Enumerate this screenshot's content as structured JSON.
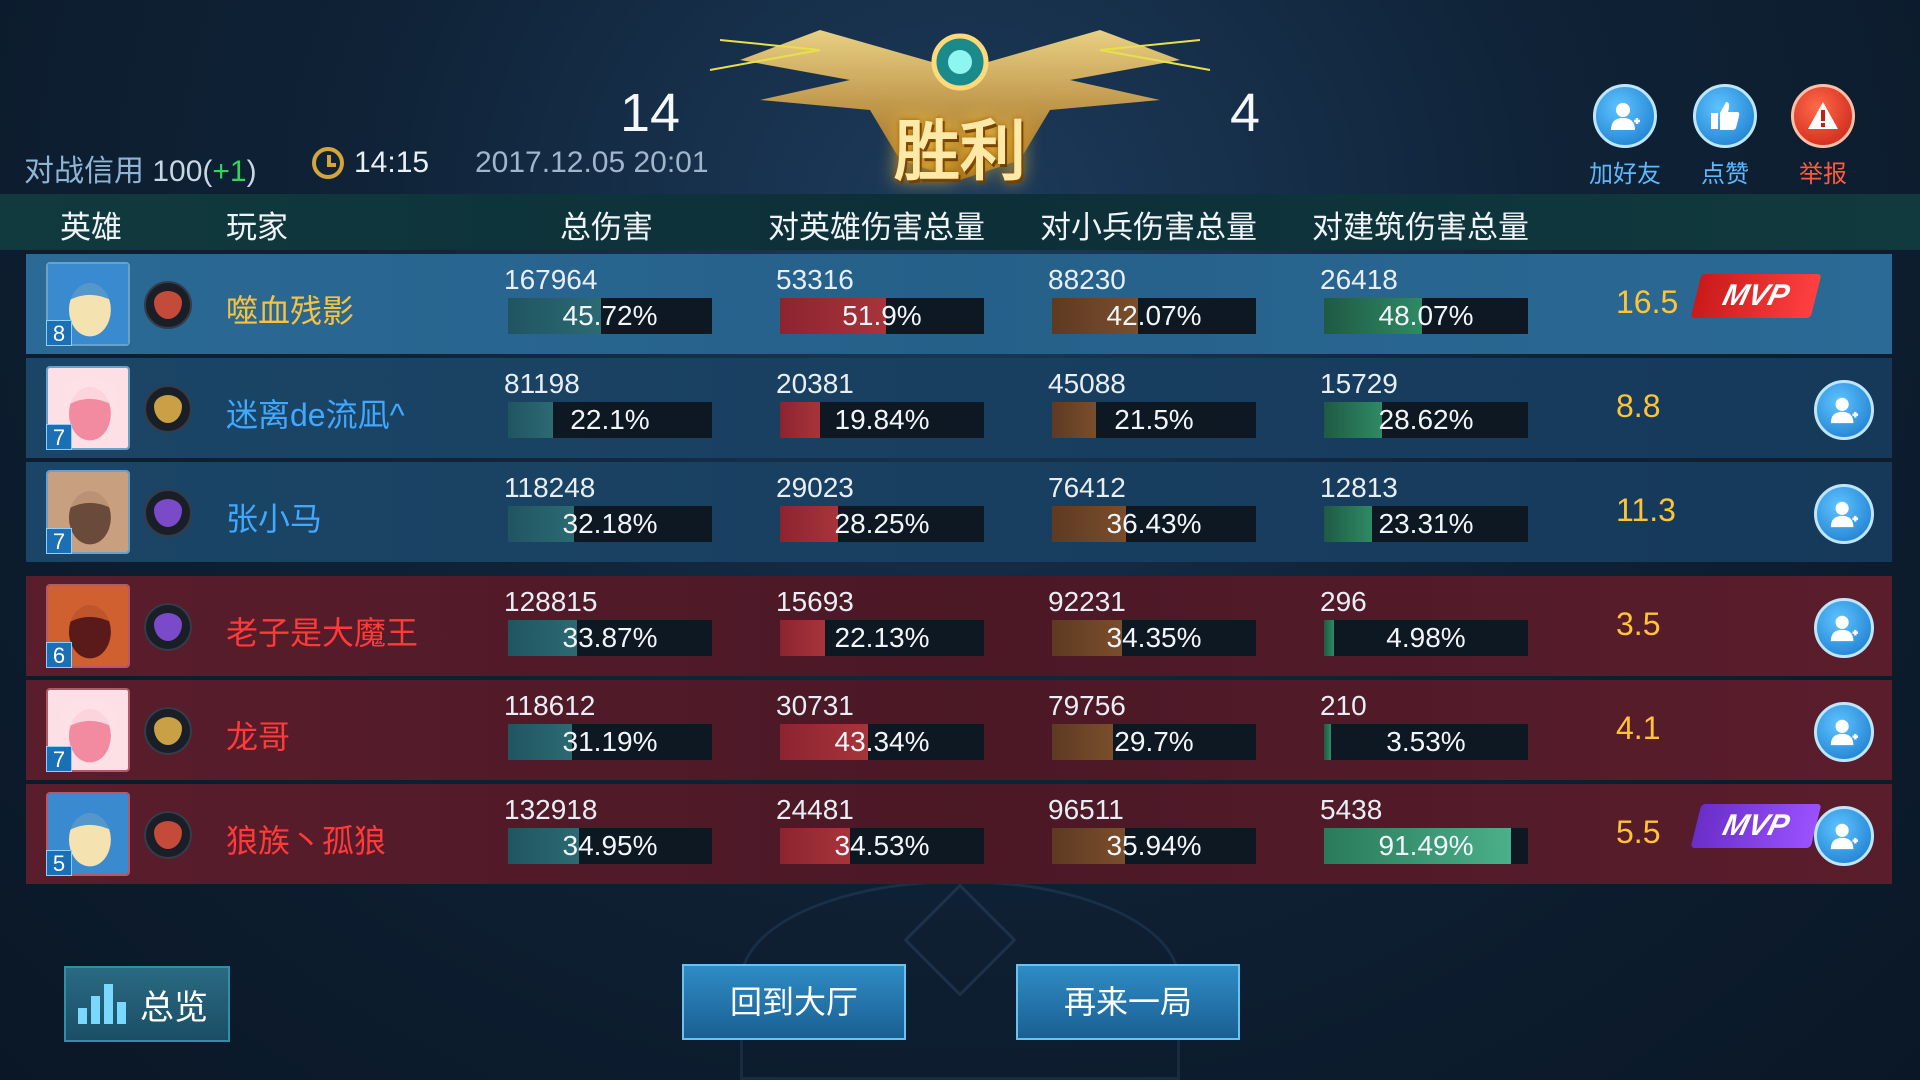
{
  "header": {
    "credit_label": "对战信用",
    "credit_value": "100(",
    "credit_delta": "+1",
    "credit_close": ")",
    "duration": "14:15",
    "datetime": "2017.12.05 20:01",
    "score_left": "14",
    "score_right": "4",
    "victory_text": "胜利",
    "actions": {
      "add_friend": "加好友",
      "like": "点赞",
      "report": "举报"
    }
  },
  "columns": {
    "hero": "英雄",
    "player": "玩家",
    "total_damage": "总伤害",
    "hero_damage": "对英雄伤害总量",
    "minion_damage": "对小兵伤害总量",
    "building_damage": "对建筑伤害总量"
  },
  "rows": [
    {
      "team": "blue",
      "level": "8",
      "name": "噬血残影",
      "name_color": "gold",
      "total": "167964",
      "total_pct": "45.72%",
      "total_frac": 0.4572,
      "hero": "53316",
      "hero_pct": "51.9%",
      "hero_frac": 0.519,
      "minion": "88230",
      "minion_pct": "42.07%",
      "minion_frac": 0.4207,
      "building": "26418",
      "building_pct": "48.07%",
      "building_frac": 0.4807,
      "rating": "16.5",
      "mvp": "MVP",
      "mvp_color": "red"
    },
    {
      "team": "blue",
      "level": "7",
      "name": "迷离de流凪^",
      "name_color": "blue",
      "total": "81198",
      "total_pct": "22.1%",
      "total_frac": 0.221,
      "hero": "20381",
      "hero_pct": "19.84%",
      "hero_frac": 0.1984,
      "minion": "45088",
      "minion_pct": "21.5%",
      "minion_frac": 0.215,
      "building": "15729",
      "building_pct": "28.62%",
      "building_frac": 0.2862,
      "rating": "8.8"
    },
    {
      "team": "blue",
      "level": "7",
      "name": "张小马",
      "name_color": "blue",
      "total": "118248",
      "total_pct": "32.18%",
      "total_frac": 0.3218,
      "hero": "29023",
      "hero_pct": "28.25%",
      "hero_frac": 0.2825,
      "minion": "76412",
      "minion_pct": "36.43%",
      "minion_frac": 0.3643,
      "building": "12813",
      "building_pct": "23.31%",
      "building_frac": 0.2331,
      "rating": "11.3"
    },
    {
      "team": "red",
      "level": "6",
      "name": "老子是大魔王",
      "name_color": "red",
      "total": "128815",
      "total_pct": "33.87%",
      "total_frac": 0.3387,
      "hero": "15693",
      "hero_pct": "22.13%",
      "hero_frac": 0.2213,
      "minion": "92231",
      "minion_pct": "34.35%",
      "minion_frac": 0.3435,
      "building": "296",
      "building_pct": "4.98%",
      "building_frac": 0.0498,
      "rating": "3.5"
    },
    {
      "team": "red",
      "level": "7",
      "name": "龙哥",
      "name_color": "red",
      "total": "118612",
      "total_pct": "31.19%",
      "total_frac": 0.3119,
      "hero": "30731",
      "hero_pct": "43.34%",
      "hero_frac": 0.4334,
      "minion": "79756",
      "minion_pct": "29.7%",
      "minion_frac": 0.297,
      "building": "210",
      "building_pct": "3.53%",
      "building_frac": 0.0353,
      "rating": "4.1"
    },
    {
      "team": "red",
      "level": "5",
      "name": "狼族丶孤狼",
      "name_color": "red",
      "total": "132918",
      "total_pct": "34.95%",
      "total_frac": 0.3495,
      "hero": "24481",
      "hero_pct": "34.53%",
      "hero_frac": 0.3453,
      "minion": "96511",
      "minion_pct": "35.94%",
      "minion_frac": 0.3594,
      "building": "5438",
      "building_pct": "91.49%",
      "building_frac": 0.9149,
      "rating": "5.5",
      "mvp": "MVP",
      "mvp_color": "purple"
    }
  ],
  "footer": {
    "overview": "总览",
    "back_to_lobby": "回到大厅",
    "play_again": "再来一局"
  }
}
